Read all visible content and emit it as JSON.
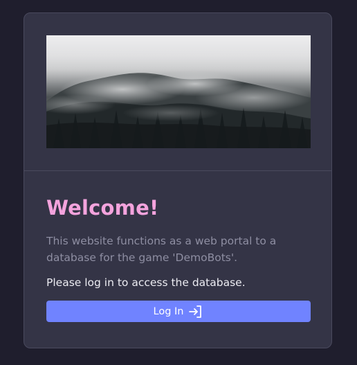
{
  "card": {
    "hero_image_alt": "Misty forested mountainside"
  },
  "welcome": {
    "title": "Welcome!",
    "description": "This website functions as a web portal to a database for the game 'DemoBots'.",
    "prompt": "Please log in to access the database."
  },
  "login_button": {
    "label": "Log In",
    "icon": "login-icon"
  },
  "colors": {
    "background": "#1f1e2d",
    "card": "#343446",
    "title": "#f4a3dd",
    "button": "#7083ff"
  }
}
